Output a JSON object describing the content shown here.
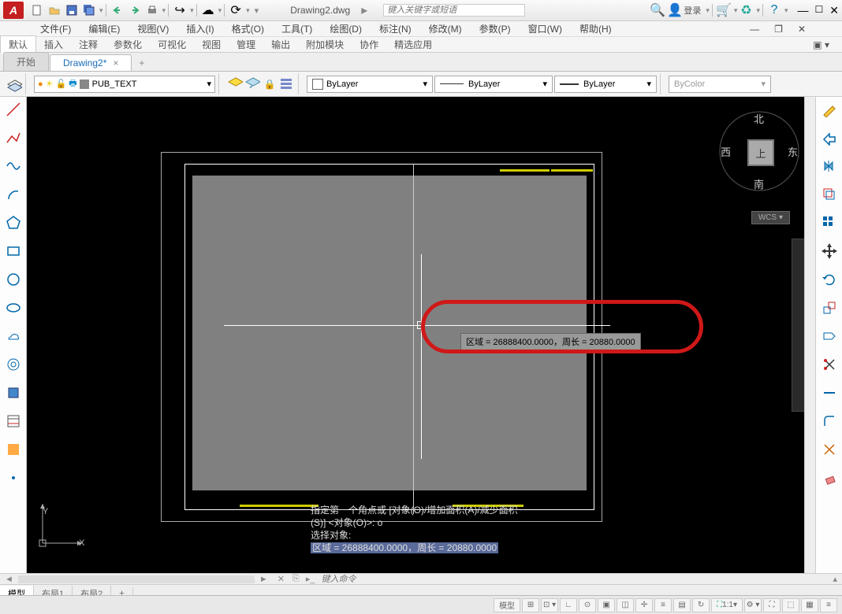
{
  "app": {
    "logo": "A",
    "filename": "Drawing2.dwg",
    "search_placeholder": "键入关键字或短语",
    "login": "登录"
  },
  "menu": [
    "文件(F)",
    "编辑(E)",
    "视图(V)",
    "插入(I)",
    "格式(O)",
    "工具(T)",
    "绘图(D)",
    "标注(N)",
    "修改(M)",
    "参数(P)",
    "窗口(W)",
    "帮助(H)"
  ],
  "ribbon": [
    "默认",
    "插入",
    "注释",
    "参数化",
    "可视化",
    "视图",
    "管理",
    "输出",
    "附加模块",
    "协作",
    "精选应用"
  ],
  "doc_tabs": {
    "start": "开始",
    "active": "Drawing2*"
  },
  "propbar": {
    "layer": "PUB_TEXT",
    "bylayer1": "ByLayer",
    "bylayer2": "ByLayer",
    "bylayer3": "ByLayer",
    "bycolor": "ByColor"
  },
  "viewcube": {
    "n": "北",
    "s": "南",
    "e": "东",
    "w": "西",
    "top": "上",
    "wcs": "WCS"
  },
  "tooltip": "区域 = 26888400.0000，周长 = 20880.0000",
  "cmd": {
    "l1": "指定第一个角点或 [对象(O)/增加面积(A)/减少面积",
    "l2": "(S)] <对象(O)>:  o",
    "l3": "选择对象:",
    "l4": "区域 = 26888400.0000，周长 = 20880.0000"
  },
  "cmdinput": "键入命令",
  "axes": {
    "x": "X",
    "y": "Y"
  },
  "bottom_tabs": [
    "模型",
    "布局1",
    "布局2"
  ],
  "status": {
    "model": "模型",
    "scale": "1:1"
  }
}
